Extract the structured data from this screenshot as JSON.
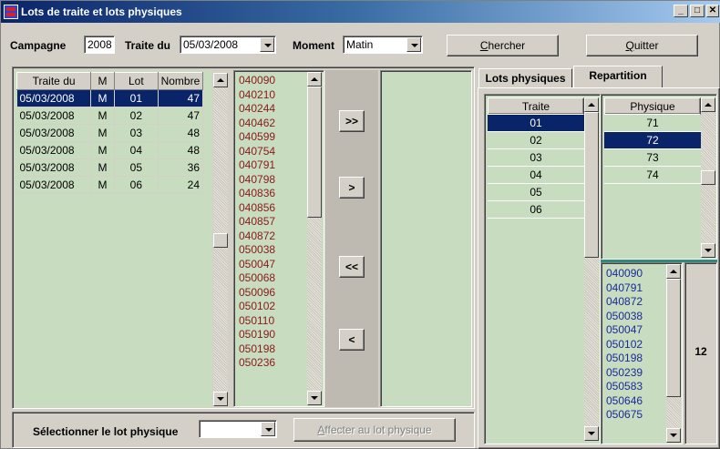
{
  "window": {
    "title": "Lots de traite et lots physiques"
  },
  "filters": {
    "campagne_label": "Campagne",
    "campagne_value": "2008",
    "traite_label": "Traite du",
    "traite_value": "05/03/2008",
    "moment_label": "Moment",
    "moment_value": "Matin"
  },
  "buttons": {
    "chercher_first": "C",
    "chercher_rest": "hercher",
    "quitter_first": "Q",
    "quitter_rest": "uitter",
    "move_all_right": ">>",
    "move_right": ">",
    "move_all_left": "<<",
    "move_left": "<",
    "affecter_first": "A",
    "affecter_rest": "ffecter au lot physique"
  },
  "lots_table": {
    "headers": [
      "Traite du",
      "M",
      "Lot",
      "Nombre"
    ],
    "rows": [
      [
        "05/03/2008",
        "M",
        "01",
        "47"
      ],
      [
        "05/03/2008",
        "M",
        "02",
        "47"
      ],
      [
        "05/03/2008",
        "M",
        "03",
        "48"
      ],
      [
        "05/03/2008",
        "M",
        "04",
        "48"
      ],
      [
        "05/03/2008",
        "M",
        "05",
        "36"
      ],
      [
        "05/03/2008",
        "M",
        "06",
        "24"
      ]
    ],
    "selected_index": 0
  },
  "animal_codes": [
    "040090",
    "040210",
    "040244",
    "040462",
    "040599",
    "040754",
    "040791",
    "040798",
    "040836",
    "040856",
    "040857",
    "040872",
    "050038",
    "050047",
    "050068",
    "050096",
    "050102",
    "050110",
    "050190",
    "050198",
    "050236"
  ],
  "bottom": {
    "select_label": "Sélectionner le lot physique",
    "select_value": ""
  },
  "tabs": {
    "lots_physiques": "Lots physiques",
    "repartition": "Repartition"
  },
  "traite_list": {
    "header": "Traite",
    "items": [
      "01",
      "02",
      "03",
      "04",
      "05",
      "06"
    ],
    "selected_index": 0
  },
  "physique_list": {
    "header": "Physique",
    "items": [
      "71",
      "72",
      "73",
      "74"
    ],
    "selected_index": 1
  },
  "repartition_codes": [
    "040090",
    "040791",
    "040872",
    "050038",
    "050047",
    "050102",
    "050198",
    "050239",
    "050583",
    "050646",
    "050675"
  ],
  "repartition_count": "12",
  "colors": {
    "selection": "#0A246A",
    "code_red": "#8B1A1A",
    "code_blue": "#1A2A9A",
    "panel_green": "#C8DCC0"
  }
}
